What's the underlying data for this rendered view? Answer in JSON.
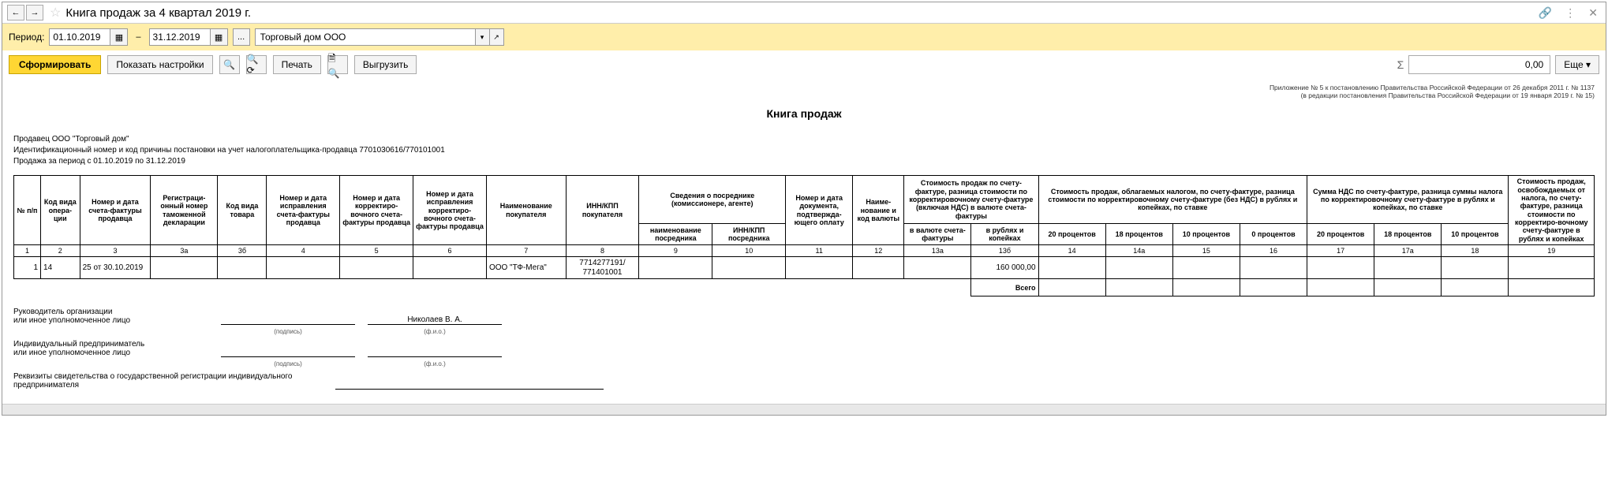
{
  "titlebar": {
    "title": "Книга продаж за 4 квартал 2019 г."
  },
  "filter": {
    "period_label": "Период:",
    "date_from": "01.10.2019",
    "date_to": "31.12.2019",
    "ellipsis": "...",
    "org": "Торговый дом ООО"
  },
  "toolbar": {
    "generate": "Сформировать",
    "show_settings": "Показать настройки",
    "print": "Печать",
    "export": "Выгрузить",
    "sum_value": "0,00",
    "more": "Еще"
  },
  "report": {
    "appendix1": "Приложение № 5 к постановлению Правительства Российской Федерации от 26 декабря 2011 г. № 1137",
    "appendix2": "(в редакции постановления Правительства Российской Федерации от 19 января 2019 г. № 15)",
    "title": "Книга продаж",
    "seller": "Продавец  ООО \"Торговый дом\"",
    "inn_kpp": "Идентификационный номер и код причины постановки на учет налогоплательщика-продавца  7701030616/770101001",
    "period": "Продажа за период с 01.10.2019 по 31.12.2019"
  },
  "headers": {
    "h1": "№ п/п",
    "h2": "Код вида опера-ции",
    "h3": "Номер и дата счета-фактуры продавца",
    "h3a": "Регистраци-онный номер таможенной декларации",
    "h3b": "Код вида товара",
    "h4": "Номер и дата исправления счета-фактуры продавца",
    "h5": "Номер и дата корректиро-вочного счета-фактуры продавца",
    "h6": "Номер и дата исправления корректиро-вочного счета-фактуры продавца",
    "h7": "Наименование покупателя",
    "h8": "ИНН/КПП покупателя",
    "h_inter": "Сведения о посреднике (комиссионере, агенте)",
    "h9": "наименование посредника",
    "h10": "ИНН/КПП посредника",
    "h11": "Номер и дата документа, подтвержда-ющего оплату",
    "h12": "Наиме-нование и код валюты",
    "h_cost": "Стоимость продаж по счету-фактуре, разница стоимости по корректировочному счету-фактуре (включая НДС) в валюте счета-фактуры",
    "h13a": "в валюте счета-фактуры",
    "h13b": "в рублях и копейках",
    "h_tax": "Стоимость продаж, облагаемых налогом, по счету-фактуре, разница стоимости по корректировочному счету-фактуре (без НДС) в рублях и копейках, по ставке",
    "h14": "20 процентов",
    "h15": "18 процентов",
    "h16": "10 процентов",
    "h17": "0 процентов",
    "h_vat": "Сумма НДС по счету-фактуре, разница суммы налога по корректировочному счету-фактуре в рублях и копейках, по ставке",
    "h18": "20 процентов",
    "h18a": "18 процентов",
    "h19": "10 процентов",
    "h20": "Стоимость продаж, освобождаемых от налога, по счету-фактуре, разница стоимости по корректиро-вочному счету-фактуре в рублях и копейках"
  },
  "colnums": {
    "c1": "1",
    "c2": "2",
    "c3": "3",
    "c3a": "3а",
    "c3b": "3б",
    "c4": "4",
    "c5": "5",
    "c6": "6",
    "c7": "7",
    "c8": "8",
    "c9": "9",
    "c10": "10",
    "c11": "11",
    "c12": "12",
    "c13a": "13а",
    "c13b": "13б",
    "c14": "14",
    "c15": "14a",
    "c16": "15",
    "c17": "16",
    "c18": "17",
    "c18a": "17a",
    "c19": "18",
    "c20": "19"
  },
  "rows": [
    {
      "n": "1",
      "op_code": "14",
      "invoice": "25 от 30.10.2019",
      "buyer": "ООО \"ТФ-Мега\"",
      "buyer_inn": "7714277191/ 771401001",
      "cost_rub": "160 000,00"
    }
  ],
  "totals": {
    "label": "Всего"
  },
  "sign": {
    "head": "Руководитель организации",
    "or_auth": "или иное уполномоченное лицо",
    "sign_caption": "(подпись)",
    "fio_caption": "(ф.и.о.)",
    "director": "Николаев В. А.",
    "ip": "Индивидуальный предприниматель",
    "req": "Реквизиты свидетельства о государственной регистрации индивидуального предпринимателя"
  }
}
